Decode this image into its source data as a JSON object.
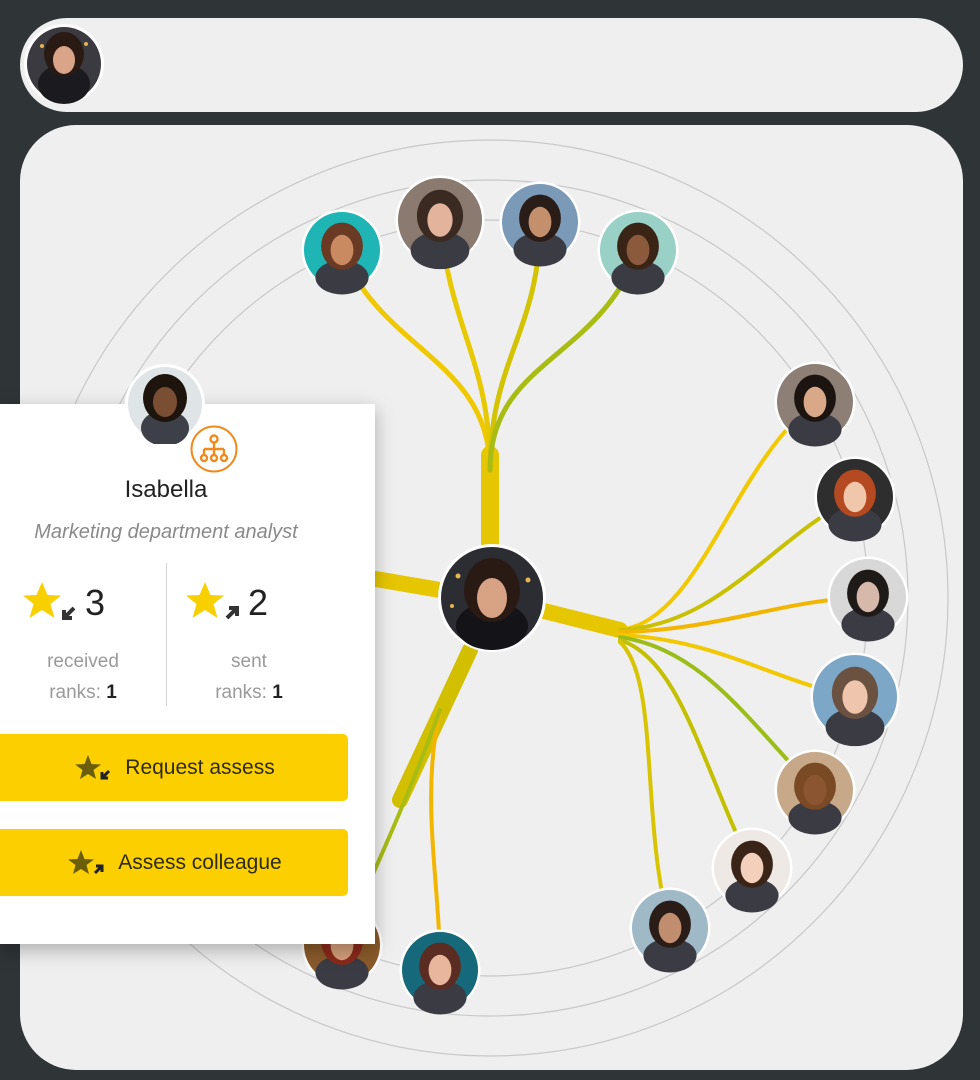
{
  "user": {
    "avatar": "user-avatar-photo"
  },
  "profile": {
    "name": "Isabella",
    "role": "Marketing department analyst",
    "received": {
      "count": "3",
      "label": "received",
      "ranks_label": "ranks:",
      "ranks_value": "1"
    },
    "sent": {
      "count": "2",
      "label": "sent",
      "ranks_label": "ranks:",
      "ranks_value": "1"
    },
    "icons": {
      "org": "org-chart-icon",
      "received": "star-arrow-in-icon",
      "sent": "star-arrow-out-icon"
    }
  },
  "actions": {
    "request_label": "Request assess",
    "assess_label": "Assess colleague"
  },
  "colors": {
    "background": "#2f3437",
    "panel": "#efefef",
    "accent_yellow": "#fcd000",
    "link_green": "#9cbc1a",
    "link_orange": "#f2b600",
    "org_icon": "#f08a1c"
  },
  "network": {
    "center_photo": "central-colleague-photo",
    "colleagues": [
      "colleague-photo-1",
      "colleague-photo-2",
      "colleague-photo-3",
      "colleague-photo-4",
      "colleague-photo-5",
      "colleague-photo-6",
      "colleague-photo-7",
      "colleague-photo-8",
      "colleague-photo-9",
      "colleague-photo-10",
      "colleague-photo-11",
      "colleague-photo-12",
      "colleague-photo-13",
      "colleague-photo-14"
    ]
  }
}
